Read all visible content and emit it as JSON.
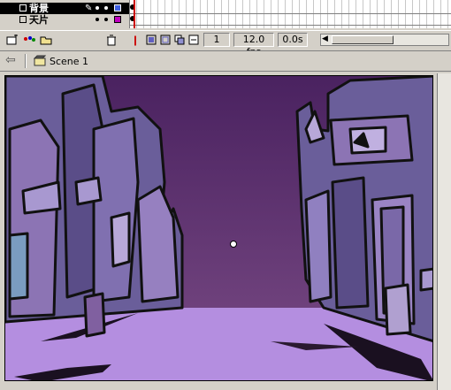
{
  "timeline": {
    "layers": [
      {
        "name": "背景",
        "selected": true
      },
      {
        "name": "天片",
        "selected": false
      }
    ],
    "frame_number": "1",
    "fps": "12.0 fps",
    "elapsed": "0.0s"
  },
  "editbar": {
    "scene_name": "Scene 1"
  },
  "stage": {
    "description_colors": {
      "sky_top": "#4a2260",
      "sky_bottom": "#7a4b85",
      "street": "#b48ee0",
      "building_main": "#6a5e9a",
      "building_light": "#8c74b4",
      "ink": "#111111"
    }
  },
  "icons": {
    "back": "back-arrow-icon",
    "scene": "scene-clapper-icon",
    "trash": "trash-icon",
    "add_layer": "add-layer-icon"
  }
}
